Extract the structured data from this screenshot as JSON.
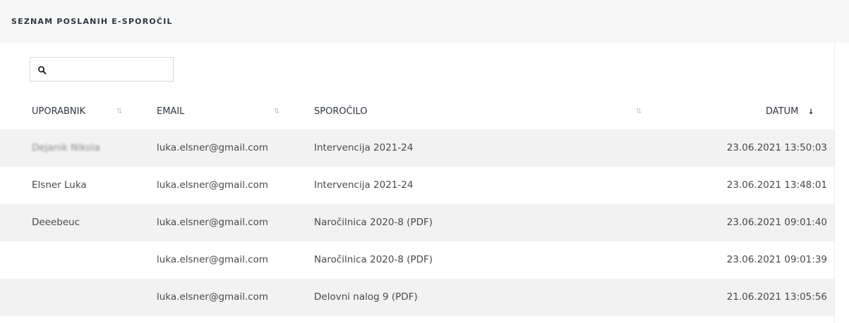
{
  "header": {
    "title": "SEZNAM POSLANIH E-SPOROČIL"
  },
  "search": {
    "value": "",
    "placeholder": "",
    "icon": "search-icon"
  },
  "table": {
    "columns": [
      {
        "label": "UPORABNIK",
        "sort": "none"
      },
      {
        "label": "EMAIL",
        "sort": "none"
      },
      {
        "label": "SPOROČILO",
        "sort": "none"
      },
      {
        "label": "DATUM",
        "sort": "descending"
      }
    ],
    "sort_icons": {
      "none": "⇅",
      "descending": "↓"
    },
    "rows": [
      {
        "user": "Dejanik Nikola",
        "email": "luka.elsner@gmail.com",
        "message": "Intervencija 2021-24",
        "date": "23.06.2021 13:50:03"
      },
      {
        "user": "Elsner Luka",
        "email": "luka.elsner@gmail.com",
        "message": "Intervencija 2021-24",
        "date": "23.06.2021 13:48:01"
      },
      {
        "user": "Deeebeuc",
        "email": "luka.elsner@gmail.com",
        "message": "Naročilnica 2020-8 (PDF)",
        "date": "23.06.2021 09:01:40"
      },
      {
        "user": "",
        "email": "luka.elsner@gmail.com",
        "message": "Naročilnica 2020-8 (PDF)",
        "date": "23.06.2021 09:01:39"
      },
      {
        "user": "",
        "email": "luka.elsner@gmail.com",
        "message": "Delovni nalog 9 (PDF)",
        "date": "21.06.2021 13:05:56"
      }
    ]
  }
}
